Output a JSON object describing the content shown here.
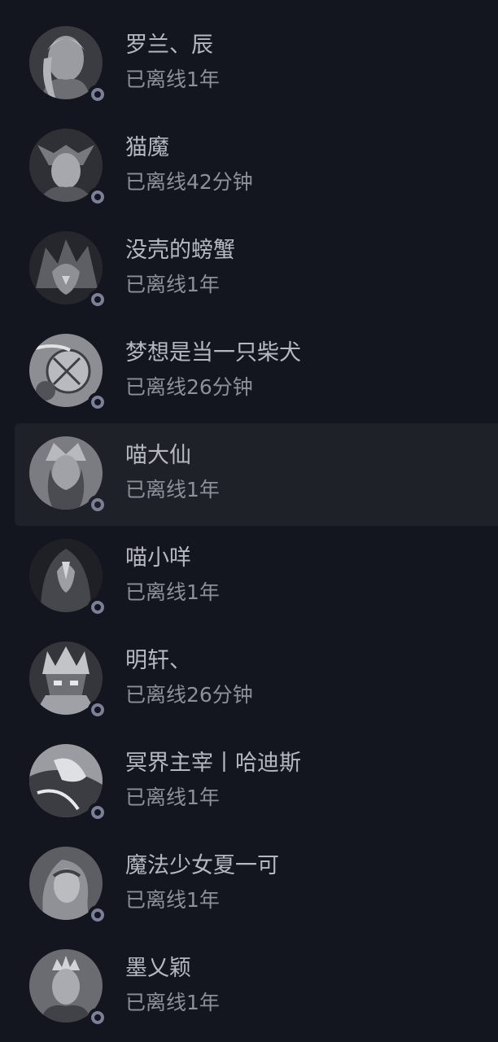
{
  "friends": [
    {
      "name": "罗兰、辰",
      "status": "已离线1年",
      "avatar_icon": "female-hero-portrait-icon"
    },
    {
      "name": "猫魔",
      "status": "已离线42分钟",
      "avatar_icon": "horned-helmet-portrait-icon"
    },
    {
      "name": "没壳的螃蟹",
      "status": "已离线1年",
      "avatar_icon": "dark-knight-portrait-icon"
    },
    {
      "name": "梦想是当一只柴犬",
      "status": "已离线26分钟",
      "avatar_icon": "clockwork-portrait-icon"
    },
    {
      "name": "喵大仙",
      "status": "已离线1年",
      "avatar_icon": "elf-queen-portrait-icon"
    },
    {
      "name": "喵小咩",
      "status": "已离线1年",
      "avatar_icon": "hooded-figure-portrait-icon"
    },
    {
      "name": "明轩、",
      "status": "已离线26分钟",
      "avatar_icon": "lich-king-portrait-icon"
    },
    {
      "name": "冥界主宰丨哈迪斯",
      "status": "已离线1年",
      "avatar_icon": "shadow-warrior-portrait-icon"
    },
    {
      "name": "魔法少女夏一可",
      "status": "已离线1年",
      "avatar_icon": "priestess-portrait-icon"
    },
    {
      "name": "墨乂颖",
      "status": "已离线1年",
      "avatar_icon": "crowned-lady-portrait-icon"
    }
  ],
  "colors": {
    "background": "#13161e",
    "selected_row": "#1f2128",
    "offline_ring": "#7b7f98"
  }
}
